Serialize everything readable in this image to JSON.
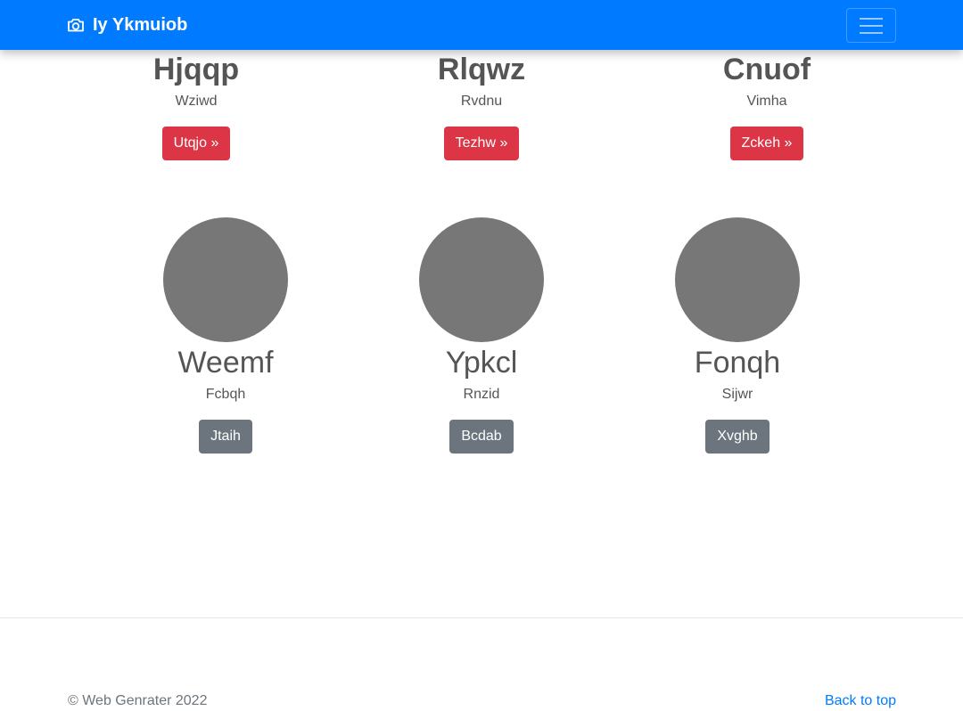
{
  "navbar": {
    "brand_icon": "camera-icon",
    "brand_text": "Iy Ykmuiob",
    "toggler_icon": "hamburger-menu-icon",
    "background_color": "#007bff"
  },
  "top_cards": [
    {
      "title": "Hjqqp",
      "subtitle": "Wziwd",
      "button_label": "Utqjo »"
    },
    {
      "title": "Rlqwz",
      "subtitle": "Rvdnu",
      "button_label": "Tezhw »"
    },
    {
      "title": "Cnuof",
      "subtitle": "Vimha",
      "button_label": "Zckeh »"
    }
  ],
  "bottom_cards": [
    {
      "title": "Weemf",
      "subtitle": "Fcbqh",
      "button_label": "Jtaih"
    },
    {
      "title": "Ypkcl",
      "subtitle": "Rnzid",
      "button_label": "Bcdab"
    },
    {
      "title": "Fonqh",
      "subtitle": "Sijwr",
      "button_label": "Xvghb"
    }
  ],
  "colors": {
    "danger_button": "#dc3545",
    "secondary_button": "#6c757d",
    "avatar_placeholder": "#777777",
    "link": "#007bff"
  },
  "footer": {
    "copyright": "© Web Genrater 2022",
    "back_to_top": "Back to top"
  }
}
